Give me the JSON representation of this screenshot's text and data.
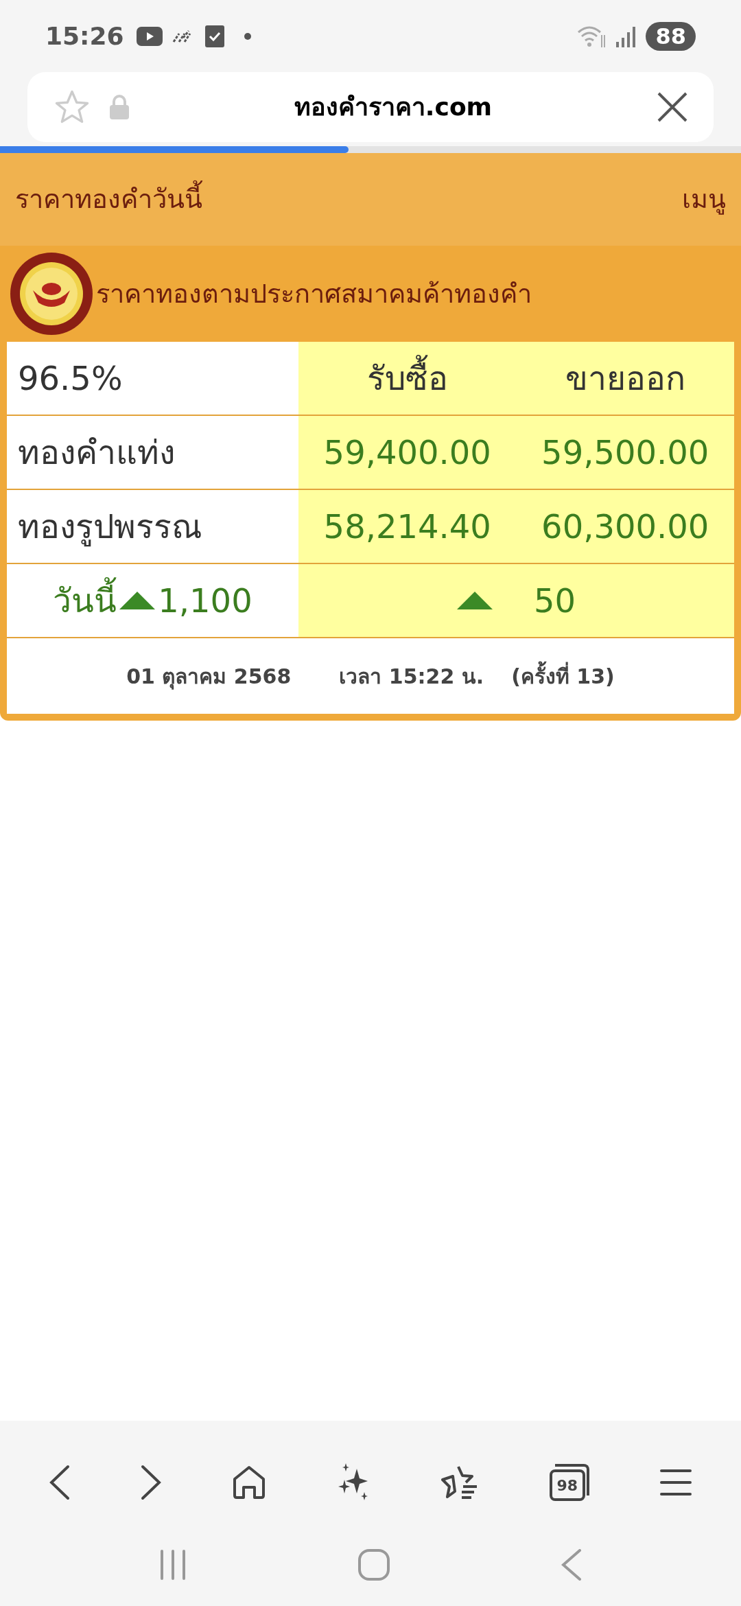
{
  "status_bar": {
    "time": "15:26",
    "battery": "88"
  },
  "browser": {
    "url": "ทองคำราคา.com",
    "progress": {
      "level": 0.47
    }
  },
  "site_header": {
    "title": "ราคาทองคำวันนี้",
    "menu": "เมนู"
  },
  "section": {
    "title": "ราคาทองตามประกาศสมาคมค้าทองคำ"
  },
  "price_table": {
    "purity": "96.5%",
    "columns": [
      "รับซื้อ",
      "ขายออก"
    ],
    "rows": [
      {
        "name": "ทองคำแท่ง",
        "buy": "59,400.00",
        "sell": "59,500.00"
      },
      {
        "name": "ทองรูปพรรณ",
        "buy": "58,214.40",
        "sell": "60,300.00"
      }
    ],
    "change": {
      "label": "วันนี้",
      "rising": true,
      "amount": "1,100",
      "rising_2": true,
      "amount_2": "50"
    },
    "footer": {
      "date": "01 ตุลาคม 2568",
      "time": "เวลา 15:22 น.",
      "round": "(ครั้งที่ 13)"
    }
  },
  "bottom_bar": {
    "tab_count": "98"
  }
}
